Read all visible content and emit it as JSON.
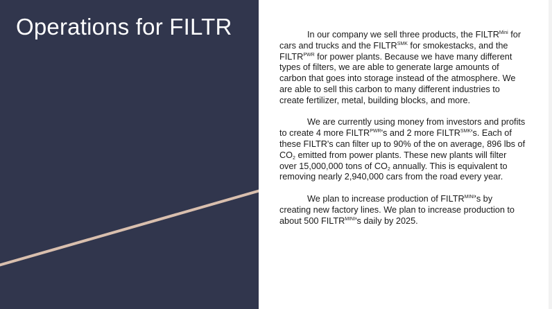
{
  "slide": {
    "title": "Operations for FILTR",
    "colors": {
      "left_panel": "#31364d",
      "accent_line": "#d9bfae",
      "title_text": "#ffffff",
      "body_text": "#1a1a1a"
    },
    "paragraphs": {
      "p1": {
        "t1": "In our company we sell three products, the FILTR",
        "s1": "Mini",
        "t2": " for cars and trucks and the FILTR",
        "s2": "SMK",
        "t3": " for smokestacks, and the FILTR",
        "s3": "PWR",
        "t4": " for power plants. Because we have many different types of filters, we are able to generate large amounts of carbon that goes into storage instead of the atmosphere. We are able to sell this carbon to many different industries to create fertilizer, metal, building blocks, and more."
      },
      "p2": {
        "t1": "We are currently using money from investors and profits to create 4 more FILTR",
        "s1": "PWR",
        "t2": "'s  and 2 more FILTR",
        "s2": "SMK",
        "t3": "'s. Each of these FILTR's can filter up to 90% of the on average, 896 lbs of CO",
        "b1": "2",
        "t4": " emitted from power plants. These new plants will filter over 15,000,000 tons of CO",
        "b2": "2",
        "t5": " annually. This is equivalent to removing nearly  2,940,000 cars from the road every year."
      },
      "p3": {
        "t1": "We plan to increase production of FILTR",
        "s1": "MINI",
        "t2": "'s by creating new factory lines. We plan to increase production to about 500 FILTR",
        "s2": "MINI",
        "t3": "'s daily by 2025."
      }
    }
  }
}
